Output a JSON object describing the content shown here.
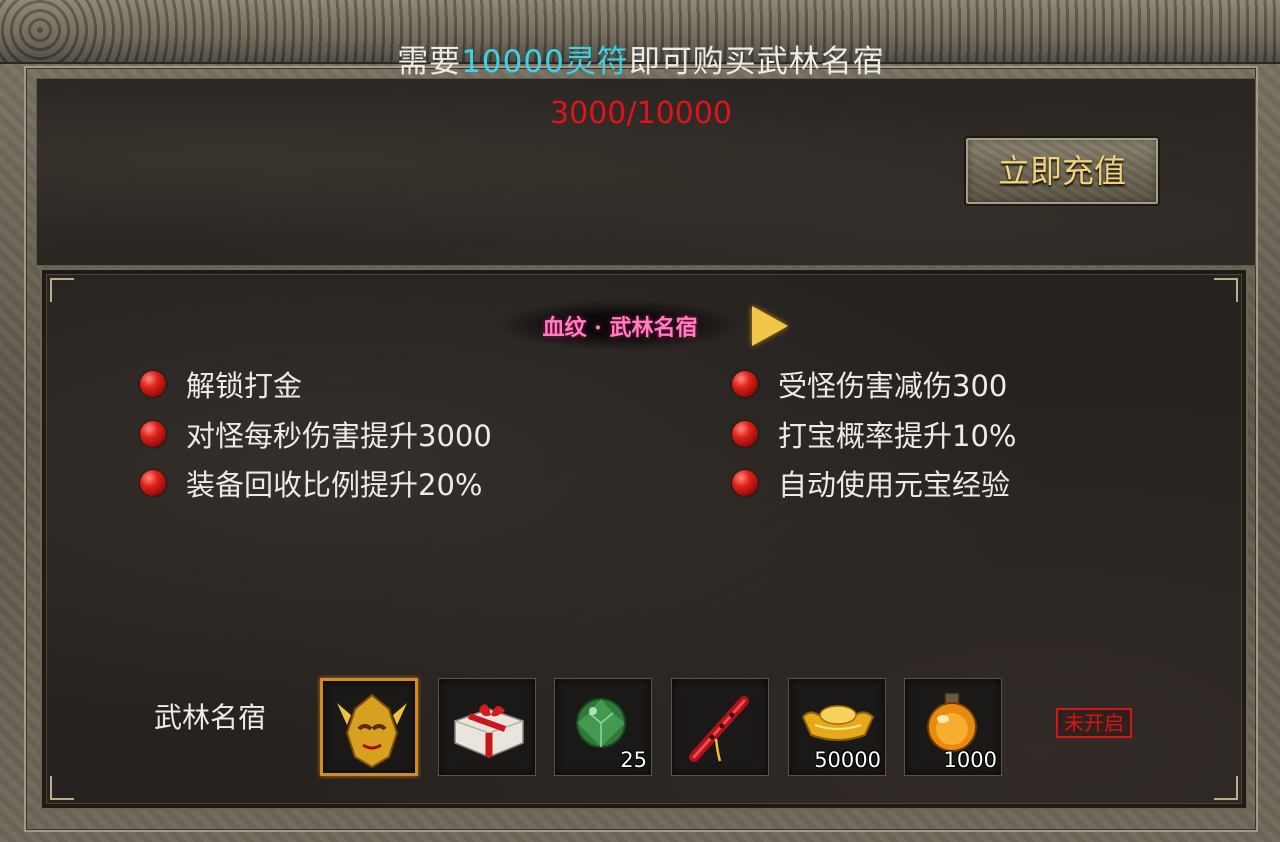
{
  "header": {
    "need_prefix": "需要",
    "need_amount": "10000灵符",
    "need_suffix": "即可购买武林名宿",
    "progress": "3000/10000",
    "progress_current": 3000,
    "progress_total": 10000,
    "recharge_label": "立即充值"
  },
  "panel": {
    "title": "血纹 · 武林名宿",
    "benefits_left": [
      "解锁打金",
      "对怪每秒伤害提升3000",
      "装备回收比例提升20%"
    ],
    "benefits_right": [
      "受怪伤害减伤300",
      "打宝概率提升10%",
      "自动使用元宝经验"
    ]
  },
  "rewards": {
    "label": "武林名宿",
    "items": [
      {
        "icon": "golden-mask-icon",
        "count": ""
      },
      {
        "icon": "gift-box-icon",
        "count": ""
      },
      {
        "icon": "green-gem-icon",
        "count": "25"
      },
      {
        "icon": "red-flute-icon",
        "count": ""
      },
      {
        "icon": "gold-ingot-icon",
        "count": "50000"
      },
      {
        "icon": "orange-potion-icon",
        "count": "1000"
      }
    ],
    "status": "未开启"
  },
  "colors": {
    "highlight": "#3ad3e8",
    "progress": "#e0121a",
    "button_text": "#f3d27a",
    "title": "#ff7fbf",
    "status": "#d81414"
  }
}
